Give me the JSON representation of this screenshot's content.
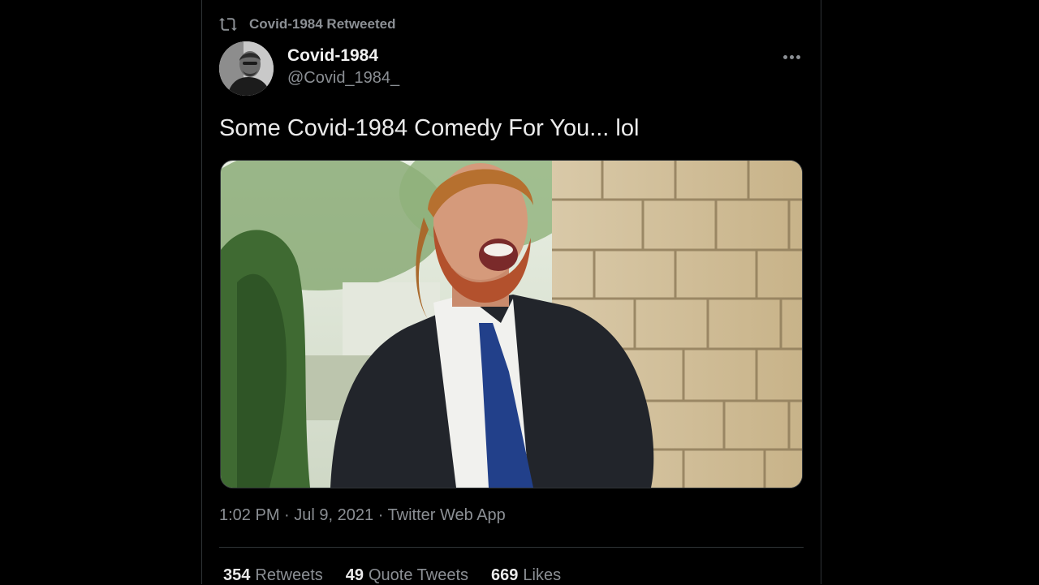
{
  "retweet": {
    "icon": "retweet-icon",
    "label": "Covid-1984 Retweeted"
  },
  "tweet": {
    "author_name": "Covid-1984",
    "author_handle": "@Covid_1984_",
    "text": "Some Covid-1984 Comedy For You... lol",
    "time": "1:02 PM",
    "date": "Jul 9, 2021",
    "source": "Twitter Web App"
  },
  "stats": {
    "retweets_count": "354",
    "retweets_label": "Retweets",
    "quotes_count": "49",
    "quotes_label": "Quote Tweets",
    "likes_count": "669",
    "likes_label": "Likes"
  },
  "colors": {
    "background": "#000000",
    "secondary_text": "#8b8f94",
    "border": "#2f3336"
  }
}
